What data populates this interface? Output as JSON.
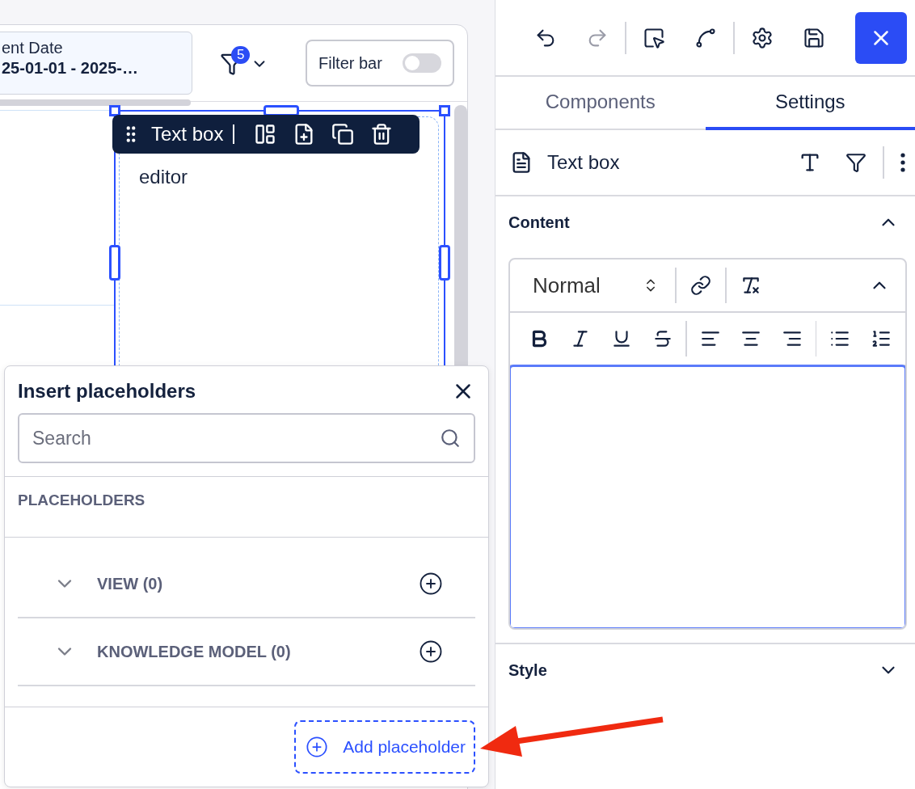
{
  "canvas": {
    "date_filter": {
      "label": "ent Date",
      "value": "25-01-01 - 2025-…"
    },
    "filter_button": {
      "badge": "5"
    },
    "filter_bar_toggle": {
      "label": "Filter bar",
      "on": false
    },
    "selected_component": {
      "toolbar_title": "Text box",
      "text": "editor"
    }
  },
  "placeholder_popover": {
    "title": "Insert placeholders",
    "search": {
      "placeholder": "Search"
    },
    "section_label": "PLACEHOLDERS",
    "groups": [
      {
        "label": "VIEW (0)",
        "expanded": false
      },
      {
        "label": "KNOWLEDGE MODEL (0)",
        "expanded": false
      }
    ],
    "add_button": "Add placeholder"
  },
  "panel": {
    "history": {
      "undo_disabled": false,
      "redo_disabled": true
    },
    "tabs": [
      {
        "label": "Components",
        "selected": false
      },
      {
        "label": "Settings",
        "selected": true
      }
    ],
    "component_title": "Text box",
    "content_section": {
      "title": "Content",
      "expanded": true
    },
    "editor": {
      "block_format": "Normal",
      "toolbar_expanded": true
    },
    "style_section": {
      "title": "Style",
      "expanded": false
    }
  }
}
